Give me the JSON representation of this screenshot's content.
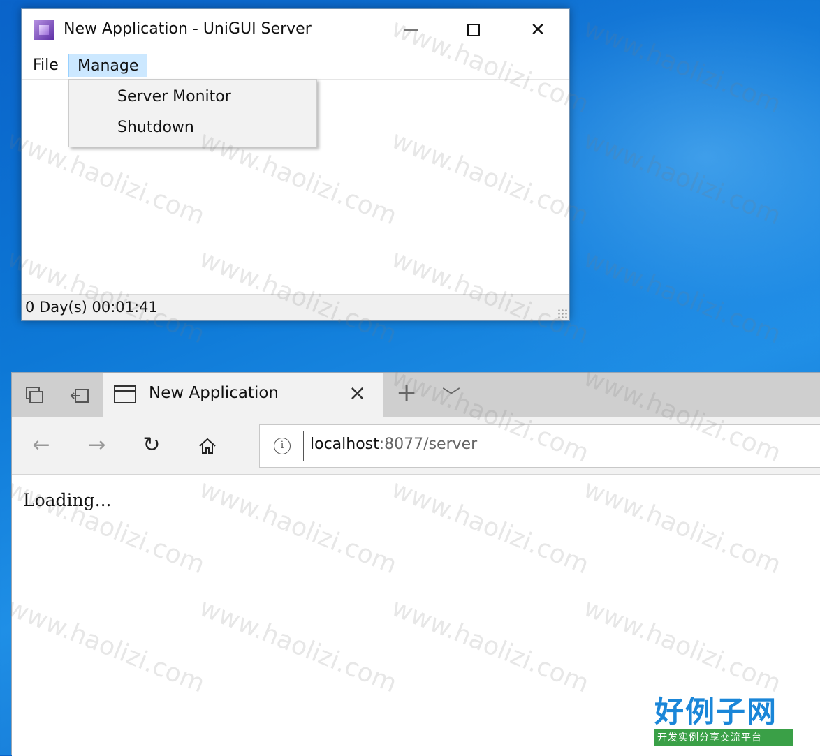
{
  "server_window": {
    "title": "New Application - UniGUI Server",
    "menu": {
      "file": "File",
      "manage": "Manage"
    },
    "dropdown": [
      "Server Monitor",
      "Shutdown"
    ],
    "status": "0 Day(s) 00:01:41"
  },
  "browser": {
    "tab_title": "New Application",
    "url_host": "localhost",
    "url_rest": ":8077/server",
    "page_text": "Loading..."
  },
  "watermark": "www.haolizi.com",
  "logo": {
    "main": "好例子网",
    "sub": "开发实例分享交流平台"
  }
}
